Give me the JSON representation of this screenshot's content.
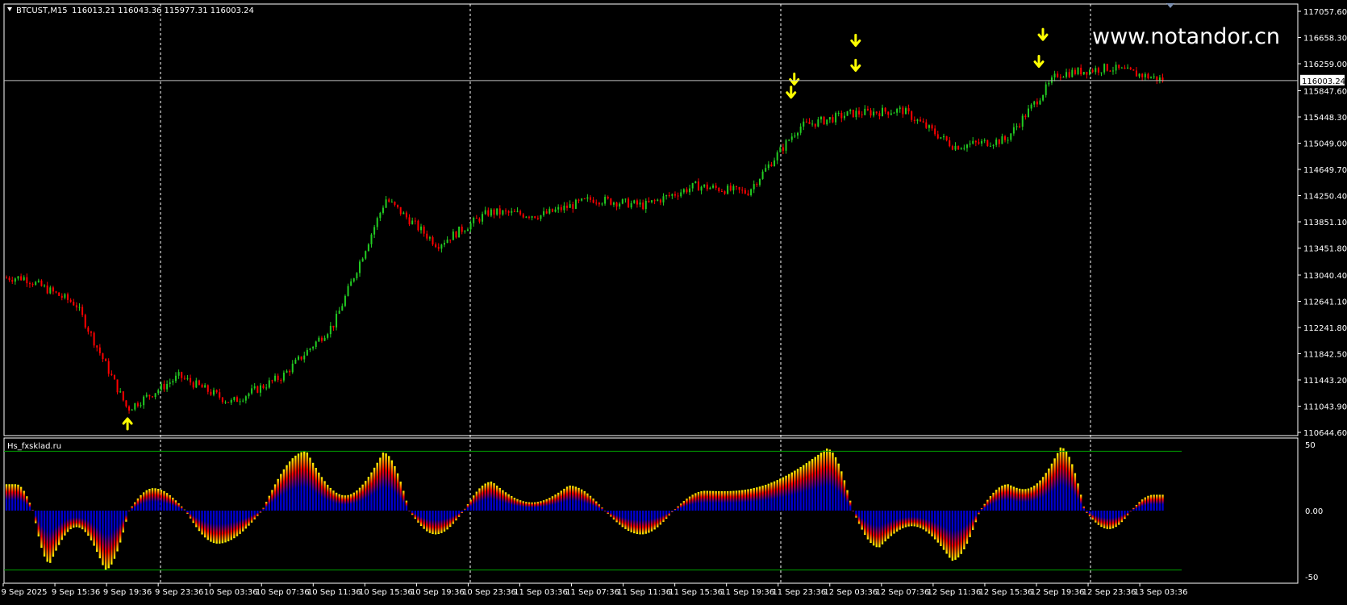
{
  "header": {
    "collapse_arrow": "triangle-down",
    "symbol_timeframe": "BTCUST,M15",
    "ohlc": "116013.21 116043.36 115977.31 116003.24"
  },
  "watermark": "www.notandor.cn",
  "indicator": {
    "name": "Hs_fxsklad.ru"
  },
  "colors": {
    "background": "#000000",
    "frame": "#ffffff",
    "bull_candle": "#22cc22",
    "bear_candle": "#ff0000",
    "arrow": "#ffff00",
    "grid_vertical": "#ffffff",
    "level_line": "#00a000",
    "histogram_base": "#0000cc",
    "histogram_mid": "#ff0000",
    "histogram_tip": "#ffff00"
  },
  "current_price_label": "116003.24",
  "price_axis": [
    "117057.60",
    "116658.30",
    "116259.00",
    "115847.60",
    "115448.30",
    "115049.00",
    "114649.70",
    "114250.40",
    "113851.10",
    "113451.80",
    "113040.40",
    "112641.10",
    "112241.80",
    "111842.50",
    "111443.20",
    "111043.90",
    "110644.60"
  ],
  "indicator_axis": [
    "50",
    "0.00",
    "-50"
  ],
  "time_axis": [
    "9 Sep 2025",
    "9 Sep 15:36",
    "9 Sep 19:36",
    "9 Sep 23:36",
    "10 Sep 03:36",
    "10 Sep 07:36",
    "10 Sep 11:36",
    "10 Sep 15:36",
    "10 Sep 19:36",
    "10 Sep 23:36",
    "11 Sep 03:36",
    "11 Sep 07:36",
    "11 Sep 11:36",
    "11 Sep 15:36",
    "11 Sep 19:36",
    "11 Sep 23:36",
    "12 Sep 03:36",
    "12 Sep 07:36",
    "12 Sep 11:36",
    "12 Sep 15:36",
    "12 Sep 19:36",
    "12 Sep 23:36",
    "13 Sep 03:36"
  ],
  "chart_data": [
    {
      "type": "candlestick",
      "title": "BTCUST,M15",
      "y_range": [
        110644.6,
        117057.6
      ],
      "current_price": 116003.24,
      "x_time_labels": [
        "9 Sep 2025",
        "9 Sep 15:36",
        "9 Sep 19:36",
        "9 Sep 23:36",
        "10 Sep 03:36",
        "10 Sep 07:36",
        "10 Sep 11:36",
        "10 Sep 15:36",
        "10 Sep 19:36",
        "10 Sep 23:36",
        "11 Sep 03:36",
        "11 Sep 07:36",
        "11 Sep 11:36",
        "11 Sep 15:36",
        "11 Sep 19:36",
        "11 Sep 23:36",
        "12 Sep 03:36",
        "12 Sep 07:36",
        "12 Sep 11:36",
        "12 Sep 15:36",
        "12 Sep 19:36",
        "12 Sep 23:36",
        "13 Sep 03:36"
      ],
      "close_path_approx": [
        [
          "9 Sep 2025",
          113000
        ],
        [
          "9 Sep 15:36",
          112600
        ],
        [
          "9 Sep 19:36",
          111000
        ],
        [
          "9 Sep 23:36",
          111500
        ],
        [
          "10 Sep 03:36",
          111100
        ],
        [
          "10 Sep 07:36",
          111500
        ],
        [
          "10 Sep 11:36",
          112300
        ],
        [
          "10 Sep 15:36",
          114200
        ],
        [
          "10 Sep 19:36",
          113500
        ],
        [
          "10 Sep 23:36",
          114000
        ],
        [
          "11 Sep 03:36",
          113950
        ],
        [
          "11 Sep 07:36",
          114200
        ],
        [
          "11 Sep 11:36",
          114100
        ],
        [
          "11 Sep 15:36",
          114400
        ],
        [
          "11 Sep 19:36",
          114300
        ],
        [
          "11 Sep 23:36",
          115300
        ],
        [
          "12 Sep 03:36",
          115500
        ],
        [
          "12 Sep 07:36",
          115550
        ],
        [
          "12 Sep 11:36",
          115000
        ],
        [
          "12 Sep 15:36",
          115100
        ],
        [
          "12 Sep 19:36",
          116100
        ],
        [
          "12 Sep 23:36",
          116200
        ],
        [
          "13 Sep 03:36",
          116003.24
        ]
      ],
      "signal_arrows": [
        {
          "time": "9 Sep 19:36",
          "direction": "up",
          "price": 110780
        },
        {
          "time": "11 Sep 23:36",
          "direction": "down",
          "price": 115820
        },
        {
          "time": "11 Sep 23:36",
          "direction": "down",
          "price": 116020
        },
        {
          "time": "12 Sep 03:36",
          "direction": "down",
          "price": 116230
        },
        {
          "time": "12 Sep 03:36",
          "direction": "down",
          "price": 116610
        },
        {
          "time": "12 Sep 19:36",
          "direction": "down",
          "price": 116290
        },
        {
          "time": "12 Sep 19:36",
          "direction": "down",
          "price": 116700
        }
      ]
    },
    {
      "type": "histogram",
      "title": "Hs_fxsklad.ru",
      "y_range": [
        -55,
        55
      ],
      "levels": [
        45,
        -45
      ],
      "wave_peaks": [
        {
          "time": "9 Sep 2025",
          "value": 20
        },
        {
          "time": "9 Sep 15:36",
          "value": -40
        },
        {
          "time": "9 Sep 19:36",
          "value": -45
        },
        {
          "time": "9 Sep 23:36",
          "value": 17
        },
        {
          "time": "10 Sep 03:36",
          "value": -25
        },
        {
          "time": "10 Sep 07:36",
          "value": 45
        },
        {
          "time": "10 Sep 15:36",
          "value": 44
        },
        {
          "time": "10 Sep 19:36",
          "value": -18
        },
        {
          "time": "10 Sep 23:36",
          "value": 22
        },
        {
          "time": "11 Sep 03:36",
          "value": 19
        },
        {
          "time": "11 Sep 11:36",
          "value": -18
        },
        {
          "time": "11 Sep 15:36",
          "value": 15
        },
        {
          "time": "11 Sep 23:36",
          "value": 47
        },
        {
          "time": "12 Sep 07:36",
          "value": -28
        },
        {
          "time": "12 Sep 11:36",
          "value": -38
        },
        {
          "time": "12 Sep 15:36",
          "value": 20
        },
        {
          "time": "12 Sep 19:36",
          "value": 48
        },
        {
          "time": "12 Sep 23:36",
          "value": -14
        },
        {
          "time": "13 Sep 03:36",
          "value": 12
        }
      ]
    }
  ]
}
